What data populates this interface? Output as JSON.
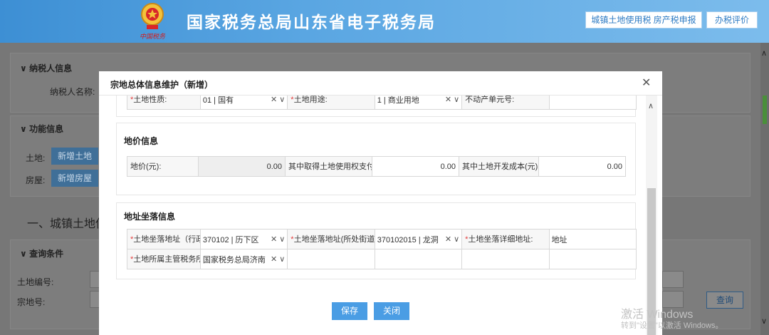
{
  "header": {
    "site_title": "国家税务总局山东省电子税务局",
    "emblem_script": "中国税务",
    "btn_land_tax": "城镇土地使用税 房产税申报",
    "btn_evaluate": "办税评价"
  },
  "background": {
    "taxpayer_section": "纳税人信息",
    "taxpayer_name_label": "纳税人名称:",
    "function_section": "功能信息",
    "land_label": "土地:",
    "add_land": "新增土地",
    "house_label": "房屋:",
    "add_house": "新增房屋",
    "big_heading": "一、城镇土地使",
    "query_section": "查询条件",
    "land_no_label": "土地编号:",
    "parcel_no_label": "宗地号:",
    "query_button": "查询"
  },
  "modal": {
    "title": "宗地总体信息维护（新增）",
    "top_row": {
      "land_nature_label": "土地性质:",
      "land_nature_value": "01 | 国有",
      "land_use_label": "土地用途:",
      "land_use_value": "1 | 商业用地",
      "property_unit_label": "不动产单元号:"
    },
    "price_section": {
      "title": "地价信息",
      "land_price_label": "地价(元):",
      "land_price_value": "0.00",
      "acquire_cost_label": "其中取得土地使用权支付金额(元):",
      "acquire_cost_value": "0.00",
      "develop_cost_label": "其中土地开发成本(元):",
      "develop_cost_value": "0.00"
    },
    "address_section": {
      "title": "地址坐落信息",
      "district_label": "土地坐落地址（行政区划）:",
      "district_value": "370102 | 历下区",
      "street_label": "土地坐落地址(所处街道):",
      "street_value": "370102015 | 龙洞",
      "detail_label": "土地坐落详细地址:",
      "detail_value": "地址",
      "tax_office_label": "土地所属主管税务所(科、分局):",
      "tax_office_value": "国家税务总局济南"
    },
    "save_button": "保存",
    "close_button": "关闭"
  },
  "watermark": {
    "line1": "激活 Windows",
    "line2": "转到\"设置\"以激活 Windows。"
  },
  "colors": {
    "header_blue": "#3d8fd4",
    "primary_button": "#4a9de4",
    "required": "#e23b3b"
  }
}
